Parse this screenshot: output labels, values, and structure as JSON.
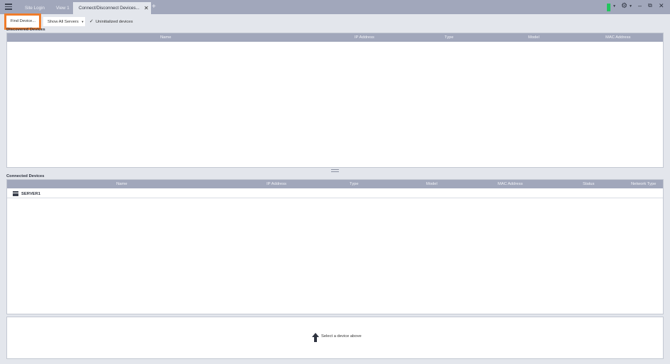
{
  "titlebar": {
    "tabs": [
      {
        "label": "Site Login"
      },
      {
        "label": "View 1"
      },
      {
        "label": "Connect/Disconnect Devices..."
      }
    ],
    "close_glyph": "✕",
    "add_glyph": "+",
    "status_color": "#22c55e",
    "icons": [
      "menu-icon",
      "settings-icon",
      "minimize-icon",
      "restore-icon",
      "close-icon"
    ]
  },
  "toolbar": {
    "find_label": "Find Device...",
    "servers_label": "Show All Servers",
    "uninit_label": "Uninitialized devices",
    "uninit_checked": true,
    "highlight_color": "#f07c2a"
  },
  "discovered": {
    "title": "Discovered Devices",
    "columns": [
      "Name",
      "IP Address",
      "Type",
      "Model",
      "MAC Address"
    ]
  },
  "connected": {
    "title": "Connected Devices",
    "columns": [
      "Name",
      "IP Address",
      "Type",
      "Model",
      "MAC Address",
      "Status",
      "Network Type"
    ],
    "rows": [
      {
        "name": "SERVER1"
      }
    ]
  },
  "details": {
    "hint": "Select a device above"
  }
}
